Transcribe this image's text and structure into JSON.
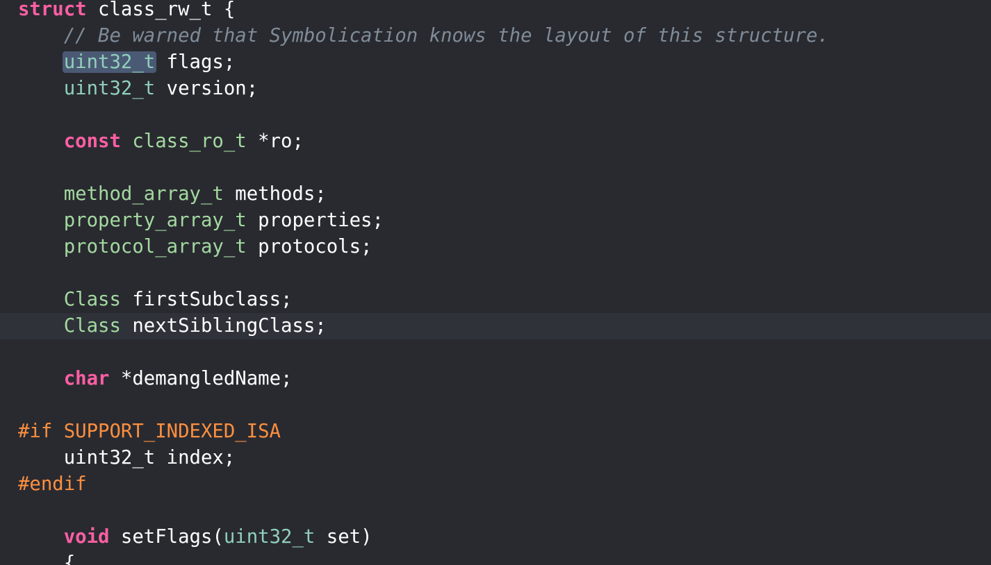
{
  "editor": {
    "theme_colors": {
      "background": "#292a30",
      "current_line": "#2f3239",
      "selection": "#4b5a74",
      "keyword": "#fc5fa3",
      "type": "#a3d9a0",
      "system_type": "#90d0bc",
      "comment": "#7f8c98",
      "preprocessor": "#fd8f3f",
      "text": "#ffffff"
    },
    "lines": [
      {
        "tokens": [
          {
            "t": "struct",
            "c": "kw"
          },
          {
            "t": " class_rw_t {",
            "c": "plain"
          }
        ]
      },
      {
        "tokens": [
          {
            "t": "    ",
            "c": "plain"
          },
          {
            "t": "// Be warned that Symbolication knows the layout of this structure.",
            "c": "cmt"
          }
        ]
      },
      {
        "tokens": [
          {
            "t": "    ",
            "c": "plain"
          },
          {
            "t": "uint32_t",
            "c": "stype",
            "selected": true
          },
          {
            "t": " flags;",
            "c": "plain"
          }
        ]
      },
      {
        "tokens": [
          {
            "t": "    ",
            "c": "plain"
          },
          {
            "t": "uint32_t",
            "c": "stype"
          },
          {
            "t": " version;",
            "c": "plain"
          }
        ]
      },
      {
        "tokens": []
      },
      {
        "tokens": [
          {
            "t": "    ",
            "c": "plain"
          },
          {
            "t": "const",
            "c": "kw"
          },
          {
            "t": " ",
            "c": "plain"
          },
          {
            "t": "class_ro_t",
            "c": "type"
          },
          {
            "t": " *ro;",
            "c": "plain"
          }
        ]
      },
      {
        "tokens": []
      },
      {
        "tokens": [
          {
            "t": "    ",
            "c": "plain"
          },
          {
            "t": "method_array_t",
            "c": "type"
          },
          {
            "t": " methods;",
            "c": "plain"
          }
        ]
      },
      {
        "tokens": [
          {
            "t": "    ",
            "c": "plain"
          },
          {
            "t": "property_array_t",
            "c": "type"
          },
          {
            "t": " properties;",
            "c": "plain"
          }
        ]
      },
      {
        "tokens": [
          {
            "t": "    ",
            "c": "plain"
          },
          {
            "t": "protocol_array_t",
            "c": "type"
          },
          {
            "t": " protocols;",
            "c": "plain"
          }
        ]
      },
      {
        "tokens": []
      },
      {
        "tokens": [
          {
            "t": "    ",
            "c": "plain"
          },
          {
            "t": "Class",
            "c": "type"
          },
          {
            "t": " firstSubclass;",
            "c": "plain"
          }
        ]
      },
      {
        "current": true,
        "tokens": [
          {
            "t": "    ",
            "c": "plain"
          },
          {
            "t": "Class",
            "c": "type"
          },
          {
            "t": " nextSiblingClass;",
            "c": "plain"
          }
        ]
      },
      {
        "tokens": []
      },
      {
        "tokens": [
          {
            "t": "    ",
            "c": "plain"
          },
          {
            "t": "char",
            "c": "kw"
          },
          {
            "t": " *demangledName;",
            "c": "plain"
          }
        ]
      },
      {
        "tokens": []
      },
      {
        "tokens": [
          {
            "t": "#if SUPPORT_INDEXED_ISA",
            "c": "pp"
          }
        ]
      },
      {
        "tokens": [
          {
            "t": "    uint32_t index;",
            "c": "plain"
          }
        ]
      },
      {
        "tokens": [
          {
            "t": "#endif",
            "c": "pp"
          }
        ]
      },
      {
        "tokens": []
      },
      {
        "tokens": [
          {
            "t": "    ",
            "c": "plain"
          },
          {
            "t": "void",
            "c": "kw"
          },
          {
            "t": " setFlags(",
            "c": "plain"
          },
          {
            "t": "uint32_t",
            "c": "stype"
          },
          {
            "t": " set)",
            "c": "plain"
          }
        ]
      },
      {
        "tokens": [
          {
            "t": "    {",
            "c": "plain"
          }
        ]
      }
    ]
  }
}
